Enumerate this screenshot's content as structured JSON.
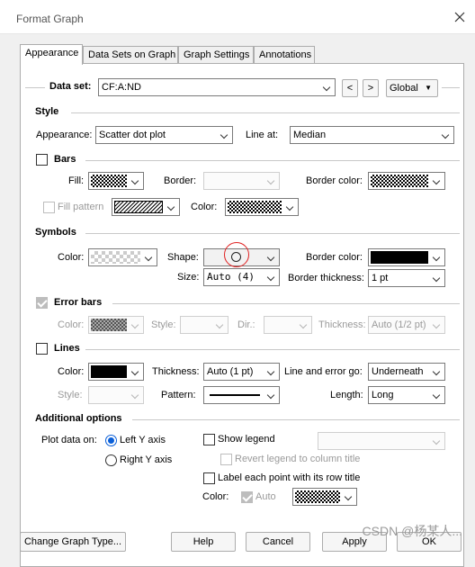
{
  "window": {
    "title": "Format Graph"
  },
  "tabs": [
    "Appearance",
    "Data Sets on Graph",
    "Graph Settings",
    "Annotations"
  ],
  "dataset": {
    "label": "Data set:",
    "value": "CF:A:ND",
    "prev": "<",
    "next": ">",
    "scope": "Global"
  },
  "style": {
    "heading": "Style",
    "appearance_label": "Appearance:",
    "appearance_value": "Scatter dot plot",
    "line_at_label": "Line at:",
    "line_at_value": "Median"
  },
  "bars": {
    "heading": "Bars",
    "fill_label": "Fill:",
    "border_label": "Border:",
    "border_color_label": "Border color:",
    "fill_pattern_label": "Fill pattern",
    "color_label": "Color:"
  },
  "symbols": {
    "heading": "Symbols",
    "color_label": "Color:",
    "shape_label": "Shape:",
    "border_color_label": "Border color:",
    "size_label": "Size:",
    "size_value": "Auto (4)",
    "border_thickness_label": "Border thickness:",
    "border_thickness_value": "1 pt",
    "highlight_color": "#e02020"
  },
  "error_bars": {
    "heading": "Error bars",
    "color_label": "Color:",
    "style_label": "Style:",
    "dir_label": "Dir.:",
    "thickness_label": "Thickness:",
    "thickness_value": "Auto (1/2 pt)"
  },
  "lines": {
    "heading": "Lines",
    "color_label": "Color:",
    "thickness_label": "Thickness:",
    "thickness_value": "Auto (1 pt)",
    "line_error_label": "Line and error go:",
    "line_error_value": "Underneath",
    "style_label": "Style:",
    "pattern_label": "Pattern:",
    "length_label": "Length:",
    "length_value": "Long"
  },
  "additional": {
    "heading": "Additional options",
    "plot_on_label": "Plot data on:",
    "left_axis": "Left Y axis",
    "right_axis": "Right  Y axis",
    "show_legend": "Show legend",
    "revert_legend": "Revert legend to column title",
    "label_each": "Label each point with its row title",
    "color_label": "Color:",
    "auto_label": "Auto"
  },
  "buttons": {
    "change_type": "Change Graph Type...",
    "help": "Help",
    "cancel": "Cancel",
    "apply": "Apply",
    "ok": "OK"
  },
  "watermark": "CSDN @杨某人..."
}
